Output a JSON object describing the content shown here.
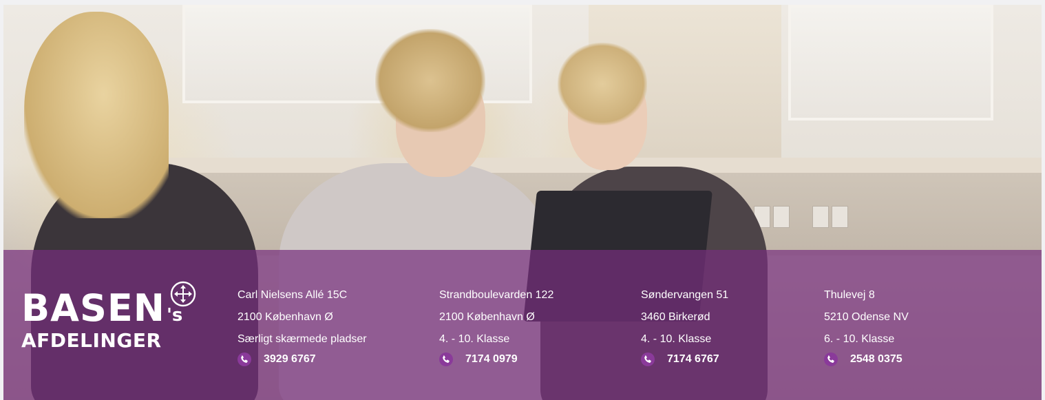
{
  "brand": {
    "word": "BASEN",
    "suffix": "'s",
    "subtitle": "AFDELINGER",
    "icon": "move-arrows-icon"
  },
  "locations": [
    {
      "address": "Carl Nielsens Allé 15C",
      "city": "2100 København Ø",
      "info": "Særligt skærmede pladser",
      "phone": "3929 6767"
    },
    {
      "address": "Strandboulevarden 122",
      "city": "2100 København Ø",
      "info": "4. - 10. Klasse",
      "phone": "7174 0979"
    },
    {
      "address": "Søndervangen 51",
      "city": "3460 Birkerød",
      "info": "4. - 10. Klasse",
      "phone": "7174 6767"
    },
    {
      "address": "Thulevej 8",
      "city": "5210 Odense NV",
      "info": "6. - 10. Klasse",
      "phone": "2548 0375"
    }
  ],
  "colors": {
    "band": "#762e7d",
    "phone_icon": "#8a3a9a",
    "text": "#ffffff"
  }
}
